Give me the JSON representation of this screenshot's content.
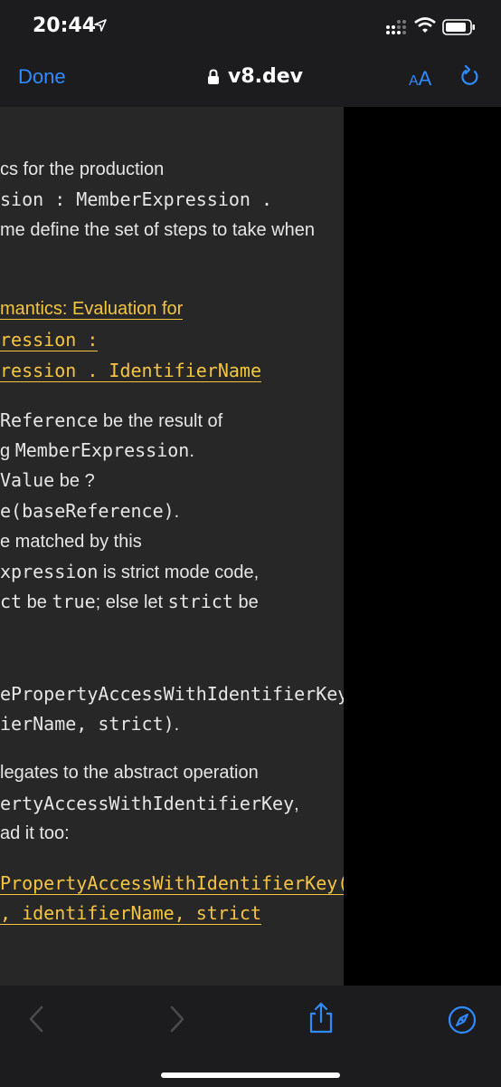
{
  "status": {
    "time": "20:44"
  },
  "nav": {
    "done_label": "Done",
    "url": "v8.dev",
    "aa_small": "A",
    "aa_big": "A"
  },
  "content": {
    "lines": [
      [
        "cs for the production"
      ],
      [
        "sion : MemberExpression ."
      ],
      [
        "me define the set of steps to take when"
      ],
      [
        "mantics: Evaluation for"
      ],
      [
        "ression :"
      ],
      [
        "ression . IdentifierName"
      ],
      [
        "Reference",
        " be the result of"
      ],
      [
        "g ",
        "MemberExpression",
        "."
      ],
      [
        "Value",
        " be ?"
      ],
      [
        "e(baseReference)",
        "."
      ],
      [
        "e matched by this"
      ],
      [
        "xpression",
        " is strict mode code,"
      ],
      [
        "ct",
        " be ",
        "true",
        "; else let ",
        "strict",
        " be"
      ],
      [
        "ePropertyAccessWithIdentifierKey(baseValue,"
      ],
      [
        "ierName, strict)",
        "."
      ],
      [
        "legates to the abstract operation"
      ],
      [
        "ertyAccessWithIdentifierKey",
        ","
      ],
      [
        "ad it too:"
      ],
      [
        "PropertyAccessWithIdentifierKey("
      ],
      [
        ", identifierName, strict"
      ]
    ]
  },
  "colors": {
    "accent": "#2f8bff",
    "link": "#f5c542",
    "page_bg": "#272727",
    "bar_bg": "#1c1c1e"
  },
  "toolbar": {
    "items": [
      "back-icon",
      "forward-icon",
      "share-icon",
      "compass-icon"
    ]
  }
}
